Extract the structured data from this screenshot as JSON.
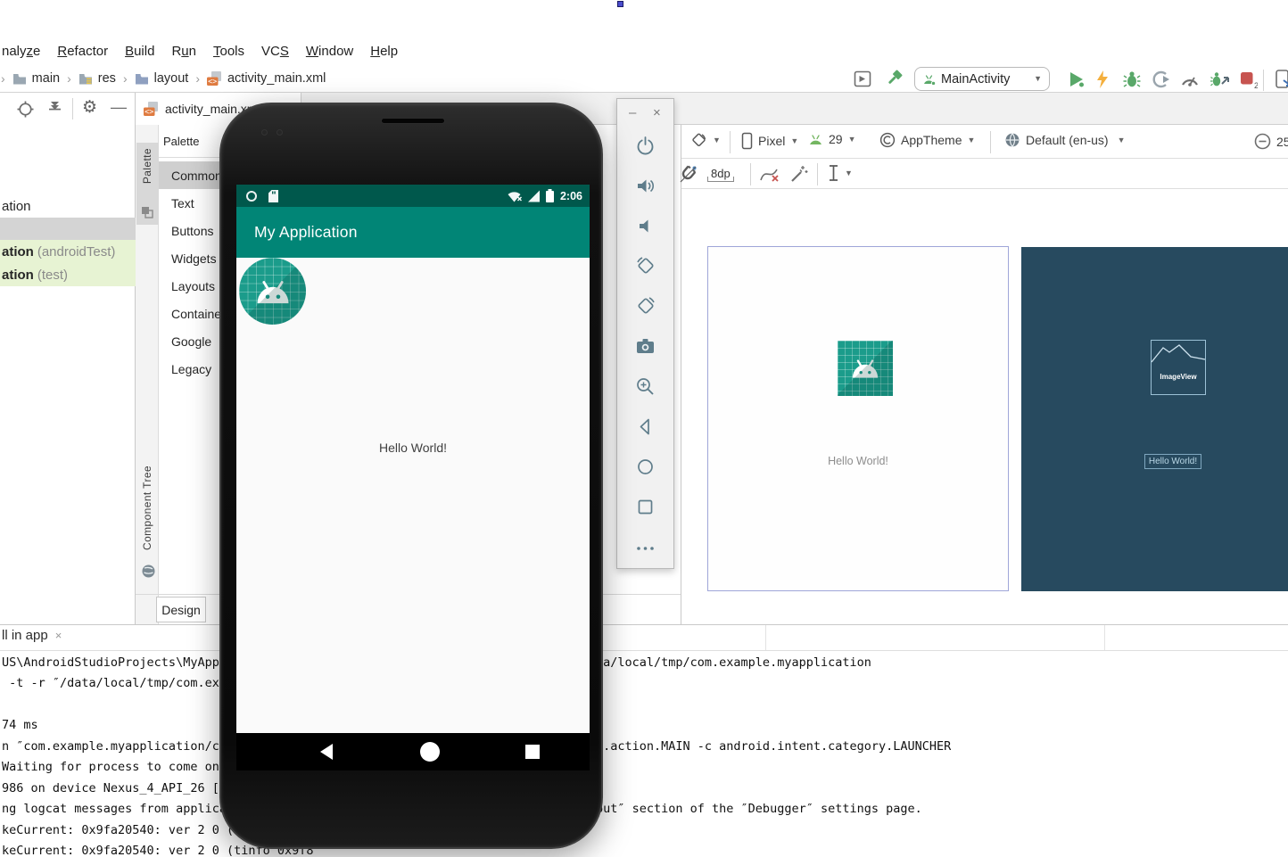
{
  "glyphs": {
    "minimize": "–",
    "close": "×",
    "caret": "▼",
    "chevron": "›",
    "gear": "⚙",
    "tab_close": "×"
  },
  "menu": {
    "items": [
      {
        "pre": "naly",
        "u": "z",
        "post": "e"
      },
      {
        "pre": "",
        "u": "R",
        "post": "efactor"
      },
      {
        "pre": "",
        "u": "B",
        "post": "uild"
      },
      {
        "pre": "R",
        "u": "u",
        "post": "n"
      },
      {
        "pre": "",
        "u": "T",
        "post": "ools"
      },
      {
        "pre": "VC",
        "u": "S",
        "post": ""
      },
      {
        "pre": "",
        "u": "W",
        "post": "indow"
      },
      {
        "pre": "",
        "u": "H",
        "post": "elp"
      }
    ]
  },
  "breadcrumb": {
    "items": [
      "main",
      "res",
      "layout",
      "activity_main.xml"
    ]
  },
  "run_toolbar": {
    "config": "MainActivity",
    "stop_badge": "2"
  },
  "project_panel": {
    "rows": [
      {
        "name": "ation",
        "suffix": ""
      },
      {
        "name": "",
        "suffix": ""
      },
      {
        "name": "ation",
        "suffix": "(androidTest)"
      },
      {
        "name": "ation",
        "suffix": "(test)"
      }
    ]
  },
  "editor": {
    "tab_title": "activity_main.xml",
    "palette_tab": "Palette",
    "palette_title": "Palette",
    "component_tree_tab": "Component Tree",
    "design_tab": "Design",
    "categories": [
      "Common",
      "Text",
      "Buttons",
      "Widgets",
      "Layouts",
      "Containers",
      "Google",
      "Legacy"
    ]
  },
  "design_toolbar": {
    "device": "Pixel",
    "api_level": "29",
    "theme": "AppTheme",
    "locale": "Default (en-us)",
    "zoom_level": "25",
    "margin": "8dp"
  },
  "preview": {
    "design_hello": "Hello World!",
    "imageview_label": "ImageView",
    "blueprint_hello": "Hello World!"
  },
  "emulator": {
    "time": "2:06",
    "app_title": "My Application",
    "hello": "Hello World!"
  },
  "console": {
    "tab": "ll in app",
    "left_lines": [
      "US\\AndroidStudioProjects\\MyAppl",
      " -t -r ″/data/local/tmp/com.exa",
      "74 ms",
      "n ″com.example.myapplication/c",
      "Waiting for process to come onl",
      "986 on device Nexus_4_API_26 [e",
      "ng logcat messages from applica",
      "keCurrent: 0x9fa20540: ver 2 0 (",
      "keCurrent: 0x9fa20540: ver 2 0 (tinfo 0x9f8"
    ],
    "right_lines": [
      "ta/local/tmp/com.example.myapplication",
      "t.action.MAIN -c android.intent.category.LAUNCHER",
      "put″ section of the ″Debugger″ settings page."
    ]
  }
}
